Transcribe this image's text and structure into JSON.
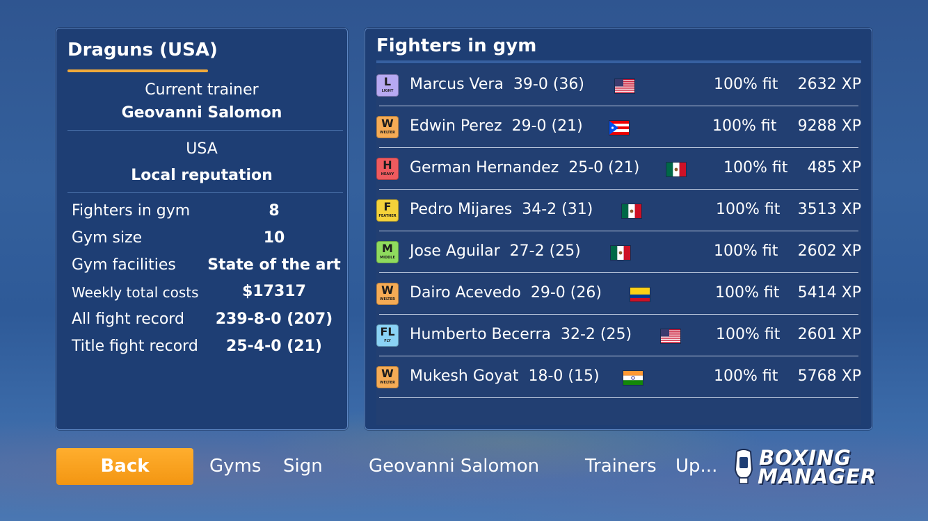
{
  "gym": {
    "title": "Draguns (USA)",
    "trainer_label": "Current trainer",
    "trainer_name": "Geovanni Salomon",
    "country": "USA",
    "reputation": "Local reputation",
    "stats": [
      {
        "label": "Fighters in gym",
        "value": "8"
      },
      {
        "label": "Gym size",
        "value": "10"
      },
      {
        "label": "Gym facilities",
        "value": "State of the art"
      },
      {
        "label": "Weekly total costs",
        "value": "$17317"
      },
      {
        "label": "All fight record",
        "value": "239-8-0 (207)"
      },
      {
        "label": "Title fight record",
        "value": "25-4-0 (21)"
      }
    ]
  },
  "fighters_panel": {
    "title": "Fighters in gym",
    "fighters": [
      {
        "wc_letter": "L",
        "wc_name": "LIGHT",
        "wc_color": "#b7a9f2",
        "name": "Marcus Vera",
        "record": "39-0 (36)",
        "flag": "usa-flag",
        "fit": "100% fit",
        "xp": "2632 XP"
      },
      {
        "wc_letter": "W",
        "wc_name": "WELTER",
        "wc_color": "#f5ab55",
        "name": "Edwin Perez",
        "record": "29-0 (21)",
        "flag": "puerto-rico-flag",
        "fit": "100% fit",
        "xp": "9288 XP"
      },
      {
        "wc_letter": "H",
        "wc_name": "HEAVY",
        "wc_color": "#ef5a5e",
        "name": "German Hernandez",
        "record": "25-0 (21)",
        "flag": "mexico-flag",
        "fit": "100% fit",
        "xp": "485 XP"
      },
      {
        "wc_letter": "F",
        "wc_name": "FEATHER",
        "wc_color": "#f4d23a",
        "name": "Pedro Mijares",
        "record": "34-2 (31)",
        "flag": "mexico-flag",
        "fit": "100% fit",
        "xp": "3513 XP"
      },
      {
        "wc_letter": "M",
        "wc_name": "MIDDLE",
        "wc_color": "#8fdb5e",
        "name": "Jose Aguilar",
        "record": "27-2 (25)",
        "flag": "mexico-flag",
        "fit": "100% fit",
        "xp": "2602 XP"
      },
      {
        "wc_letter": "W",
        "wc_name": "WELTER",
        "wc_color": "#f5ab55",
        "name": "Dairo Acevedo",
        "record": "29-0 (26)",
        "flag": "colombia-flag",
        "fit": "100% fit",
        "xp": "5414 XP"
      },
      {
        "wc_letter": "FL",
        "wc_name": "FLY",
        "wc_color": "#8ad2f5",
        "name": "Humberto Becerra",
        "record": "32-2 (25)",
        "flag": "usa-flag",
        "fit": "100% fit",
        "xp": "2601 XP"
      },
      {
        "wc_letter": "W",
        "wc_name": "WELTER",
        "wc_color": "#f5ab55",
        "name": "Mukesh Goyat",
        "record": "18-0 (15)",
        "flag": "india-flag",
        "fit": "100% fit",
        "xp": "5768 XP"
      }
    ]
  },
  "bottom_bar": {
    "back": "Back",
    "gyms": "Gyms",
    "sign": "Sign",
    "trainer": "Geovanni Salomon",
    "trainers": "Trainers",
    "upgrade": "Up...",
    "logo_line1": "BOXING",
    "logo_line2": "MANAGER"
  },
  "colors": {
    "accent": "#f0a93a",
    "panel": "#1e3e74",
    "button": "#f7a21f"
  }
}
